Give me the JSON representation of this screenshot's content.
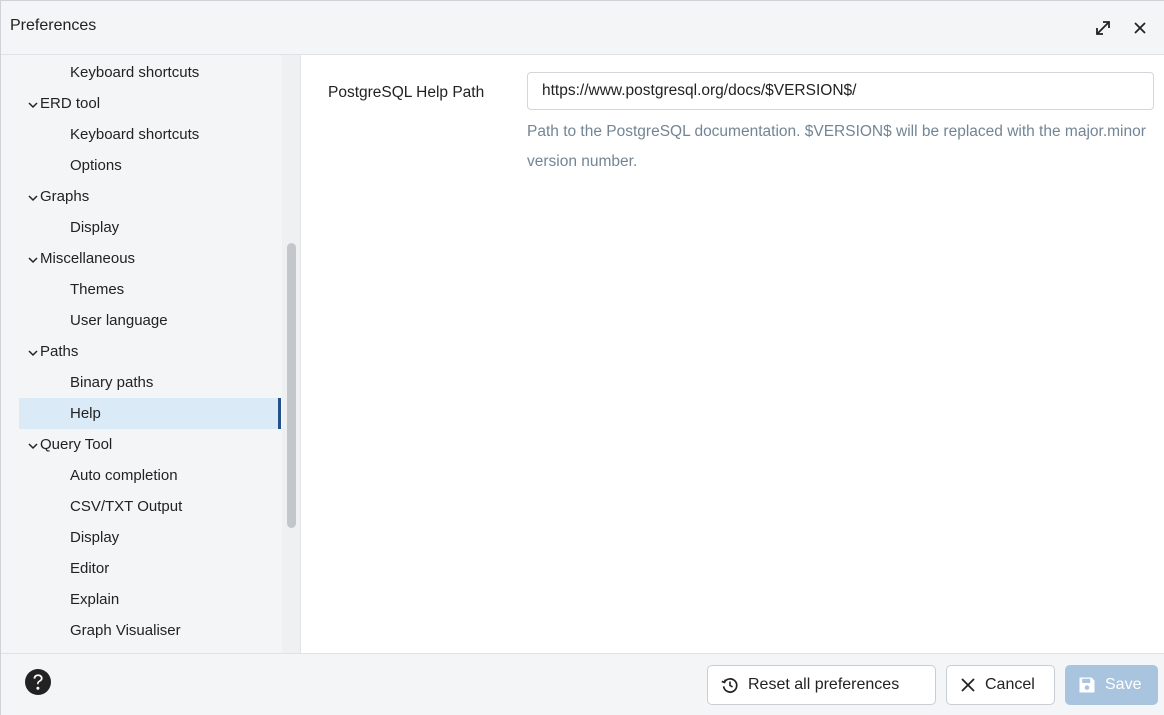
{
  "window": {
    "title": "Preferences",
    "expand_icon": "expand-icon",
    "close_icon": "close-icon"
  },
  "sidebar": {
    "items": [
      {
        "label": "Keyboard shortcuts",
        "level": "child"
      },
      {
        "label": "ERD tool",
        "level": "parent",
        "expanded": true
      },
      {
        "label": "Keyboard shortcuts",
        "level": "child"
      },
      {
        "label": "Options",
        "level": "child"
      },
      {
        "label": "Graphs",
        "level": "parent",
        "expanded": true
      },
      {
        "label": "Display",
        "level": "child"
      },
      {
        "label": "Miscellaneous",
        "level": "parent",
        "expanded": true
      },
      {
        "label": "Themes",
        "level": "child"
      },
      {
        "label": "User language",
        "level": "child"
      },
      {
        "label": "Paths",
        "level": "parent",
        "expanded": true
      },
      {
        "label": "Binary paths",
        "level": "child"
      },
      {
        "label": "Help",
        "level": "child",
        "selected": true
      },
      {
        "label": "Query Tool",
        "level": "parent",
        "expanded": true
      },
      {
        "label": "Auto completion",
        "level": "child"
      },
      {
        "label": "CSV/TXT Output",
        "level": "child"
      },
      {
        "label": "Display",
        "level": "child"
      },
      {
        "label": "Editor",
        "level": "child"
      },
      {
        "label": "Explain",
        "level": "child"
      },
      {
        "label": "Graph Visualiser",
        "level": "child"
      }
    ]
  },
  "main": {
    "field": {
      "label": "PostgreSQL Help Path",
      "value": "https://www.postgresql.org/docs/$VERSION$/",
      "help": "Path to the PostgreSQL documentation. $VERSION$ will be replaced with the major.minor version number."
    }
  },
  "footer": {
    "help_icon": "question-circle-icon",
    "reset_label": "Reset all preferences",
    "reset_icon": "reset-icon",
    "cancel_label": "Cancel",
    "cancel_icon": "close-icon",
    "save_label": "Save",
    "save_icon": "save-icon",
    "save_enabled": false
  },
  "colors": {
    "selected_bg": "#dbeaf7",
    "selected_bar": "#23518c",
    "help_text": "#738594",
    "save_disabled_bg": "#a9c4de"
  }
}
